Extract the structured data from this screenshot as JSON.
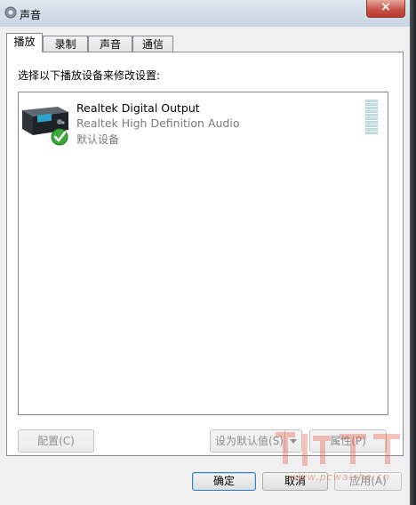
{
  "window": {
    "title": "声音",
    "close_icon": "×"
  },
  "tabs": [
    {
      "label": "播放",
      "active": true
    },
    {
      "label": "录制",
      "active": false
    },
    {
      "label": "声音",
      "active": false
    },
    {
      "label": "通信",
      "active": false
    }
  ],
  "panel": {
    "instruction": "选择以下播放设备来修改设置:"
  },
  "devices": [
    {
      "name": "Realtek Digital Output",
      "driver": "Realtek High Definition Audio",
      "status": "默认设备",
      "icon": "speaker-device-icon",
      "default_badge_icon": "check-circle-icon"
    }
  ],
  "panel_buttons": {
    "configure": "配置(C)",
    "set_default": "设为默认值(S)",
    "properties": "属性(P)"
  },
  "dialog_buttons": {
    "ok": "确定",
    "cancel": "取消",
    "apply": "应用(A)"
  },
  "watermark": {
    "text": "www.pcwaishe.cn"
  },
  "colors": {
    "titlebar": "#c9d6e3",
    "close_button": "#c8554a",
    "check_badge": "#3aa93a",
    "level_meter": "#cfe6e8"
  }
}
